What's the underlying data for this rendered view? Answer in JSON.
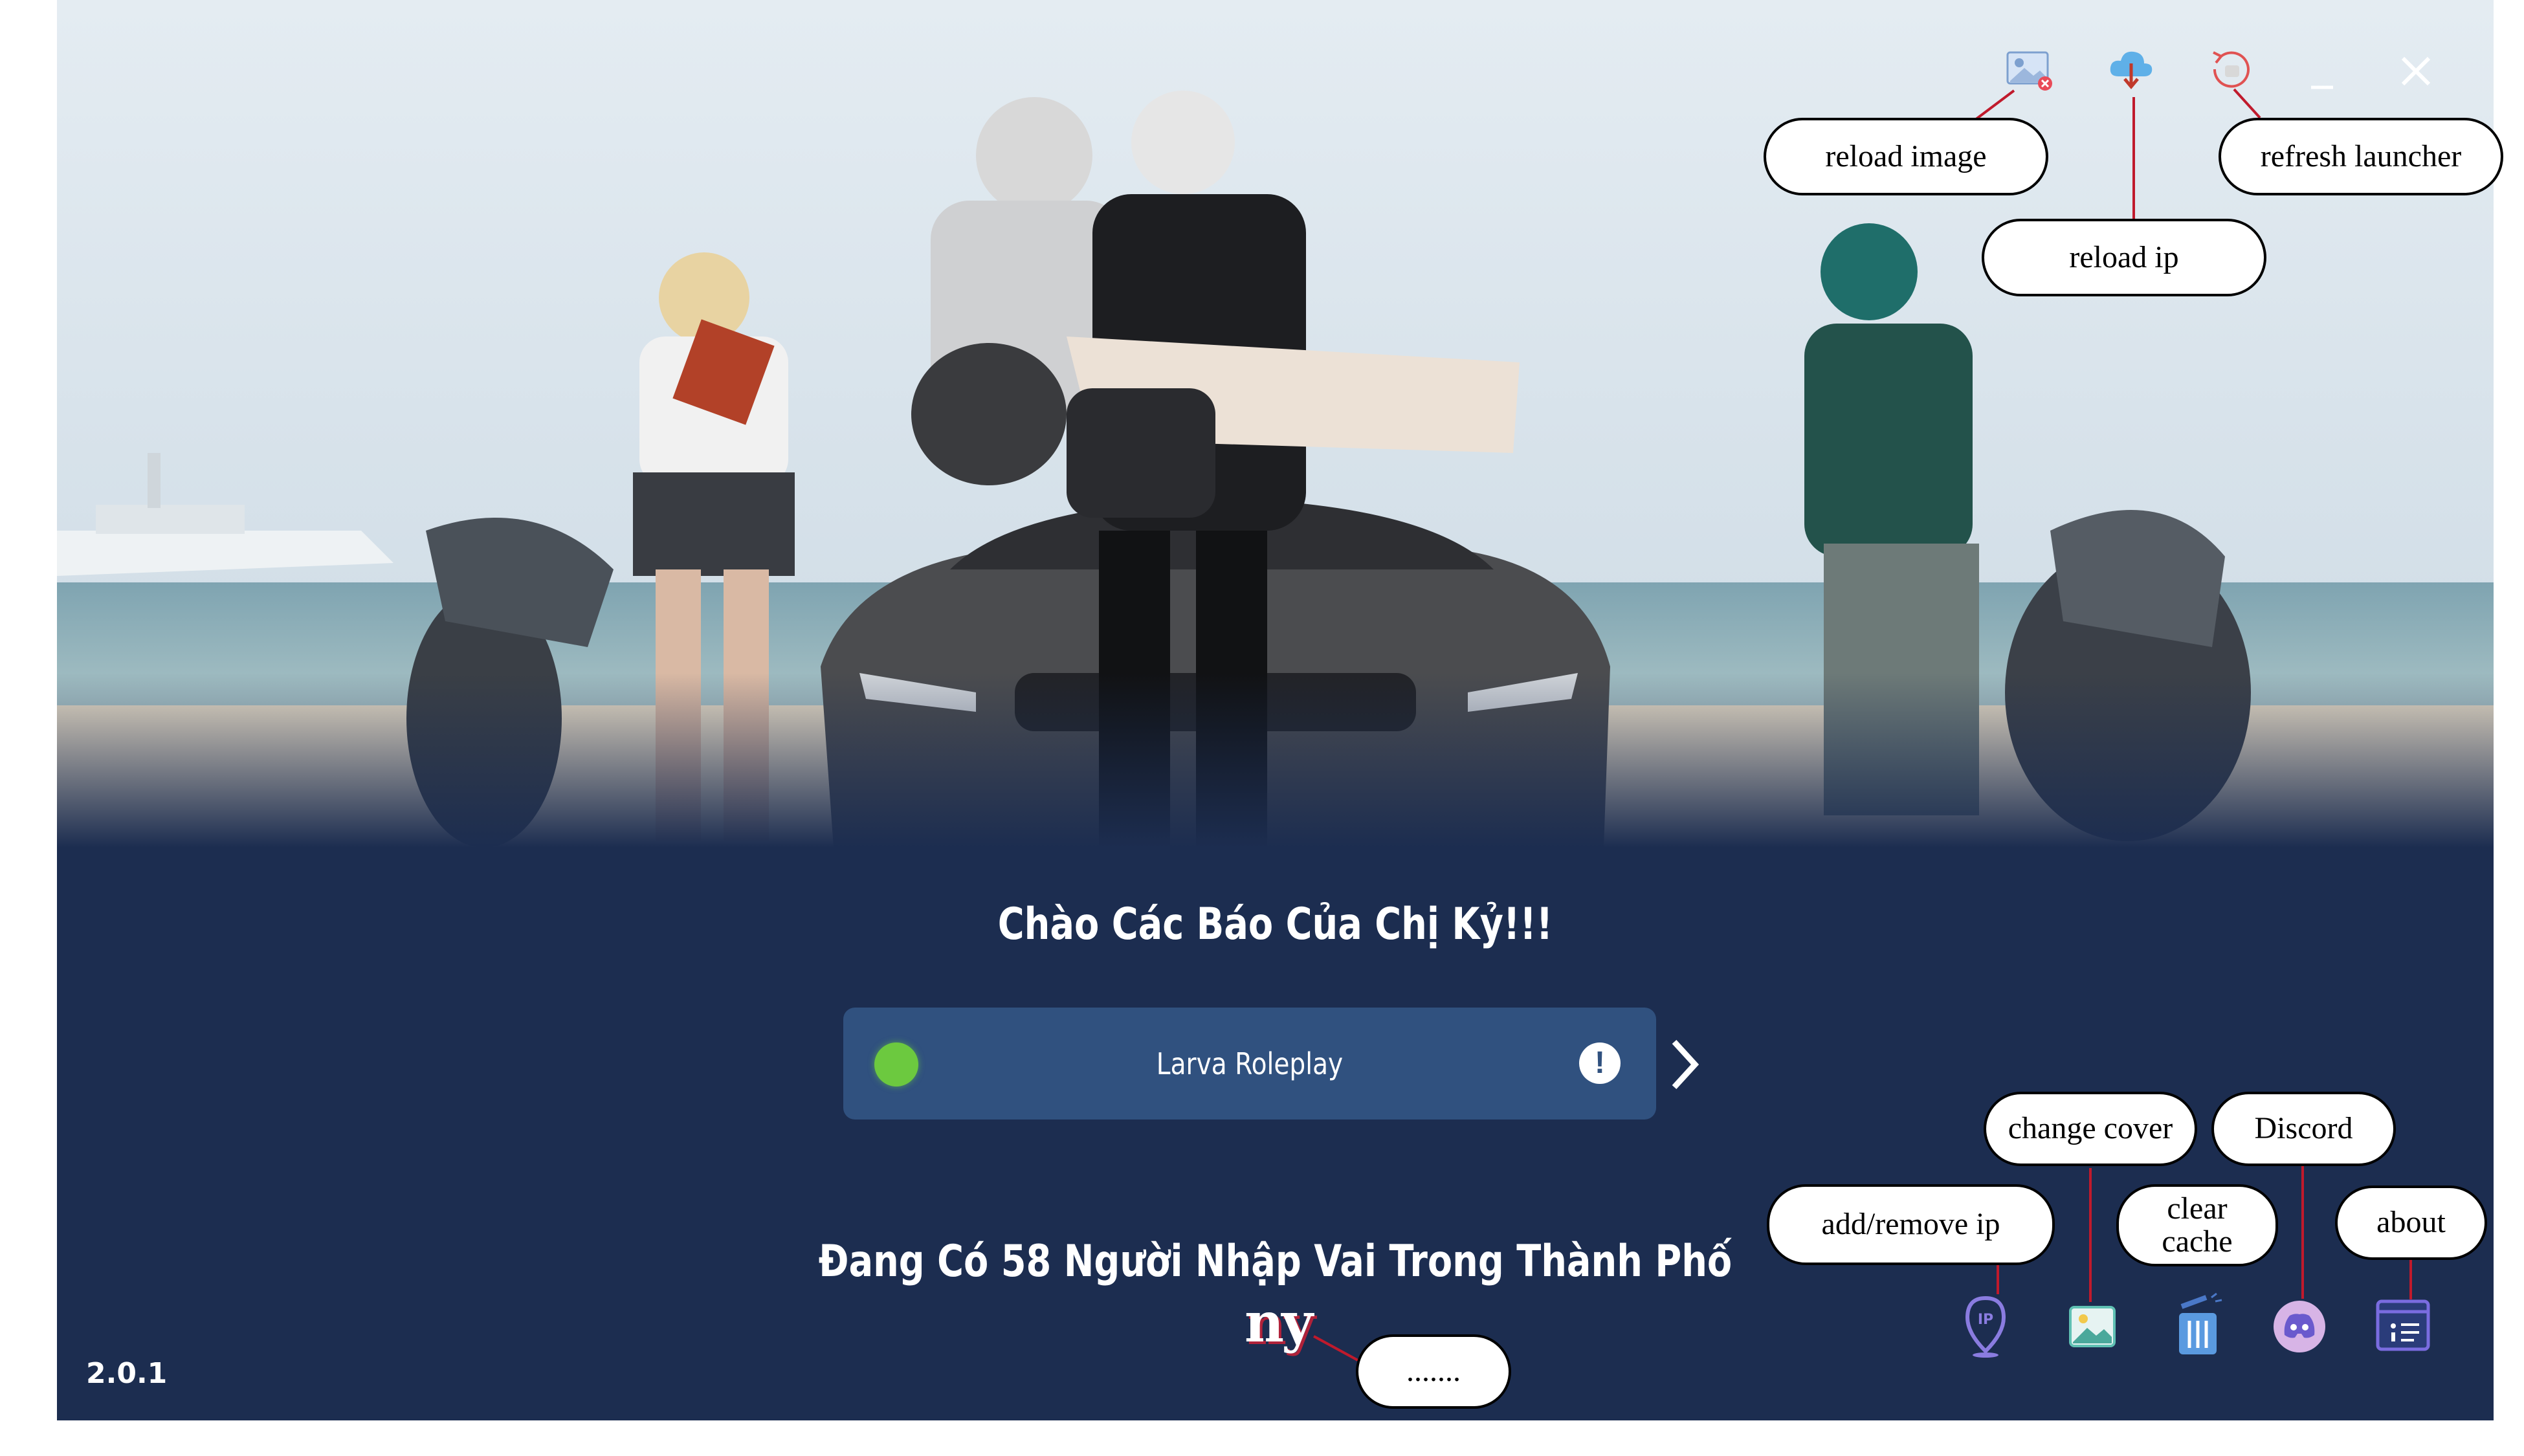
{
  "app": {
    "welcome": "Chào Các Báo Của Chị Kỷ!!!",
    "server": {
      "name": "Larva Roleplay",
      "status_color": "#6cc93f",
      "info_symbol": "!"
    },
    "players_text": "Đang Có 58 Người Nhập Vai Trong Thành Phố",
    "logo_text": "ny",
    "version": "2.0.1",
    "colors": {
      "background": "#1c2d50",
      "server_card": "#30517f",
      "status_online": "#6cc93f",
      "leader_line": "#c01a2c"
    }
  },
  "toolbar": {
    "icons": [
      "reload-image-icon",
      "reload-ip-icon",
      "refresh-launcher-icon",
      "minimize-icon",
      "close-icon"
    ]
  },
  "bottom_bar": {
    "icons": [
      "ip-location-icon",
      "image-icon",
      "trash-icon",
      "discord-icon",
      "about-icon"
    ]
  },
  "annotations": {
    "reload_image": "reload image",
    "reload_ip": "reload ip",
    "refresh_launcher": "refresh launcher",
    "change_cover": "change cover",
    "discord": "Discord",
    "add_remove_ip": "add/remove ip",
    "clear_cache": "clear cache",
    "about": "about",
    "logo_note": "......."
  }
}
